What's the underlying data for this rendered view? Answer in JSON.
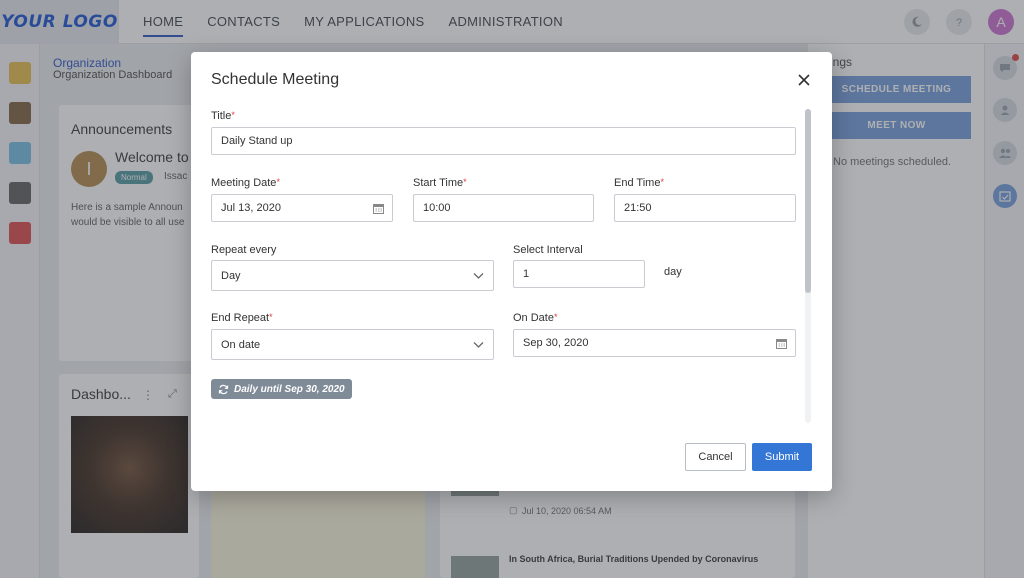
{
  "brand": {
    "logo_text": "YOUR LOGO",
    "accent": "#3376d6"
  },
  "nav": {
    "items": [
      {
        "label": "HOME",
        "active": true
      },
      {
        "label": "CONTACTS"
      },
      {
        "label": "MY APPLICATIONS"
      },
      {
        "label": "ADMINISTRATION"
      }
    ]
  },
  "user": {
    "avatar_initial": "A"
  },
  "page": {
    "breadcrumb": "Organization",
    "subtitle": "Organization Dashboard"
  },
  "announcements": {
    "title": "Announcements",
    "avatar_initial": "I",
    "welcome": "Welcome to",
    "badge": "Normal",
    "author": "Issac",
    "body_line1": "Here is a sample Announ",
    "body_line2": "would be visible to all use"
  },
  "dashboard_card": {
    "title": "Dashbo..."
  },
  "meetings_panel": {
    "title": "etings",
    "schedule_button": "SCHEDULE MEETING",
    "meet_now_button": "MEET NOW",
    "empty_text": "No meetings scheduled."
  },
  "news": {
    "date": "Jul 10, 2020 06:54 AM",
    "title2": "In South Africa, Burial Traditions Upended by Coronavirus"
  },
  "modal": {
    "title": "Schedule Meeting",
    "title_label": "Title",
    "title_value": "Daily Stand up",
    "meeting_date_label": "Meeting Date",
    "meeting_date_value": "Jul 13, 2020",
    "start_time_label": "Start Time",
    "start_time_value": "10:00",
    "end_time_label": "End Time",
    "end_time_value": "21:50",
    "repeat_label": "Repeat every",
    "repeat_value": "Day",
    "interval_label": "Select Interval",
    "interval_value": "1",
    "interval_unit": "day",
    "end_repeat_label": "End Repeat",
    "end_repeat_value": "On date",
    "on_date_label": "On Date",
    "on_date_value": "Sep 30, 2020",
    "summary": "Daily until Sep 30, 2020",
    "required_mark": "*",
    "cancel_label": "Cancel",
    "submit_label": "Submit"
  }
}
